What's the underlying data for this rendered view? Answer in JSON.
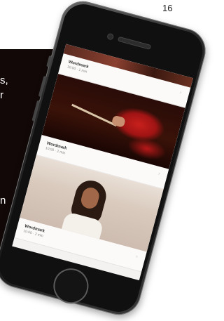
{
  "page_number": "16",
  "cutoff_text": {
    "upper": "s,\nr",
    "lower": "n"
  },
  "phone_screen": {
    "cards": [
      {
        "title": "Wordmark",
        "meta": "10:00 · 1 min",
        "action_icon": "chevron-icon"
      },
      {
        "title": "Wordmark",
        "meta": "10:00 · 2 min",
        "action_icon": "chevron-icon"
      },
      {
        "title": "Wordmark",
        "meta": "10:00 · 2 min",
        "action_icon": "chevron-icon"
      }
    ]
  }
}
